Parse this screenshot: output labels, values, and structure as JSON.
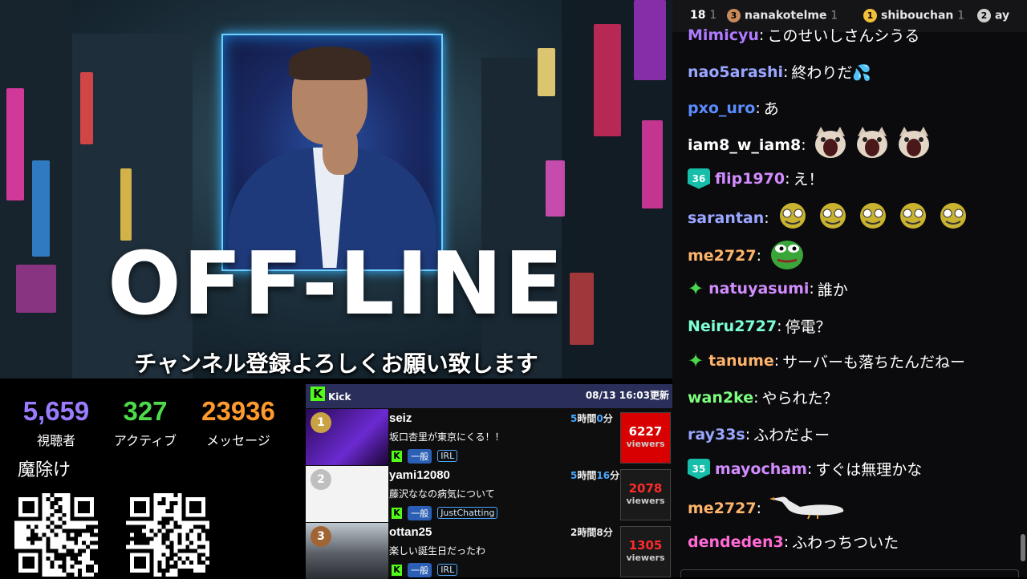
{
  "banner": {
    "big_text": "OFF-LINE",
    "subtitle": "チャンネル登録よろしくお願い致します"
  },
  "stats": [
    {
      "value": "5,659",
      "label": "視聴者",
      "color": "#9b7bff"
    },
    {
      "value": "327",
      "label": "アクティブ",
      "color": "#4ddb4a"
    },
    {
      "value": "23936",
      "label": "メッセージ",
      "color": "#ff9a2e"
    }
  ],
  "amulet_label": "魔除け",
  "kick": {
    "title": "Kick",
    "logo": "K",
    "date": "08/13 16:03更新",
    "rows": [
      {
        "rank": "1",
        "name": "seiz",
        "time_h": "5",
        "time_h_unit": "時間",
        "time_m": "0",
        "time_m_unit": "分",
        "title": "坂口杏里が東京にくる！！",
        "category": "一般",
        "tag": "IRL",
        "viewers": "6227",
        "viewers_label": "viewers",
        "view_color": "#e00000"
      },
      {
        "rank": "2",
        "name": "yami12080",
        "time_h": "5",
        "time_h_unit": "時間",
        "time_m": "16",
        "time_m_unit": "分",
        "title": "藤沢ななの病気について",
        "category": "一般",
        "tag": "JustChatting",
        "viewers": "2078",
        "viewers_label": "viewers",
        "view_color": "#ff2a2a"
      },
      {
        "rank": "3",
        "name": "ottan25",
        "time_h": "2",
        "time_h_unit": "時間",
        "time_m": "8",
        "time_m_unit": "分",
        "title": "楽しい誕生日だったわ",
        "category": "一般",
        "tag": "IRL",
        "viewers": "1305",
        "viewers_label": "viewers",
        "view_color": "#ff2a2a"
      }
    ]
  },
  "chat": {
    "topbar": [
      {
        "rank": "",
        "name": "18",
        "count": "1"
      },
      {
        "rank": "3",
        "name": "nanakotelme",
        "count": "1"
      },
      {
        "rank": "1",
        "name": "shibouchan",
        "count": "1"
      },
      {
        "rank": "2",
        "name": "ay",
        "count": ""
      }
    ],
    "messages": [
      {
        "user": "Mimicyu",
        "color": "#b07bff",
        "text": "このせいしさんシうる"
      },
      {
        "user": "nao5arashi",
        "color": "#9aa6ff",
        "text": "終わりだ💦"
      },
      {
        "user": "pxo_uro",
        "color": "#5b8dff",
        "text": "あ"
      },
      {
        "user": "iam8_w_iam8",
        "color": "#ffffff",
        "text": "",
        "emote": "cat",
        "emote_count": 3
      },
      {
        "user": "flip1970",
        "color": "#d28cff",
        "text": "え！",
        "badge": "36"
      },
      {
        "user": "sarantan",
        "color": "#9aa6ff",
        "text": "",
        "emote": "smile",
        "emote_count": 5
      },
      {
        "user": "me2727",
        "color": "#ffb46b",
        "text": "",
        "emote": "pepe",
        "emote_count": 1
      },
      {
        "user": "natuyasumi",
        "color": "#d28cff",
        "text": "誰か",
        "sparkle": true
      },
      {
        "user": "Neiru2727",
        "color": "#7fffd4",
        "text": "停電？"
      },
      {
        "user": "tanume",
        "color": "#ffb46b",
        "text": "サーバーも落ちたんだねー",
        "sparkle": true
      },
      {
        "user": "wan2ke",
        "color": "#7dff7d",
        "text": "やられた？"
      },
      {
        "user": "ray33s",
        "color": "#9aa6ff",
        "text": "ふわだよー"
      },
      {
        "user": "mayocham",
        "color": "#d28cff",
        "text": "すぐは無理かな",
        "badge": "35"
      },
      {
        "user": "me2727",
        "color": "#ffb46b",
        "text": "",
        "emote": "goose",
        "emote_count": 1
      },
      {
        "user": "dendeden3",
        "color": "#ff6ad5",
        "text": "ふわっちついた"
      }
    ]
  }
}
